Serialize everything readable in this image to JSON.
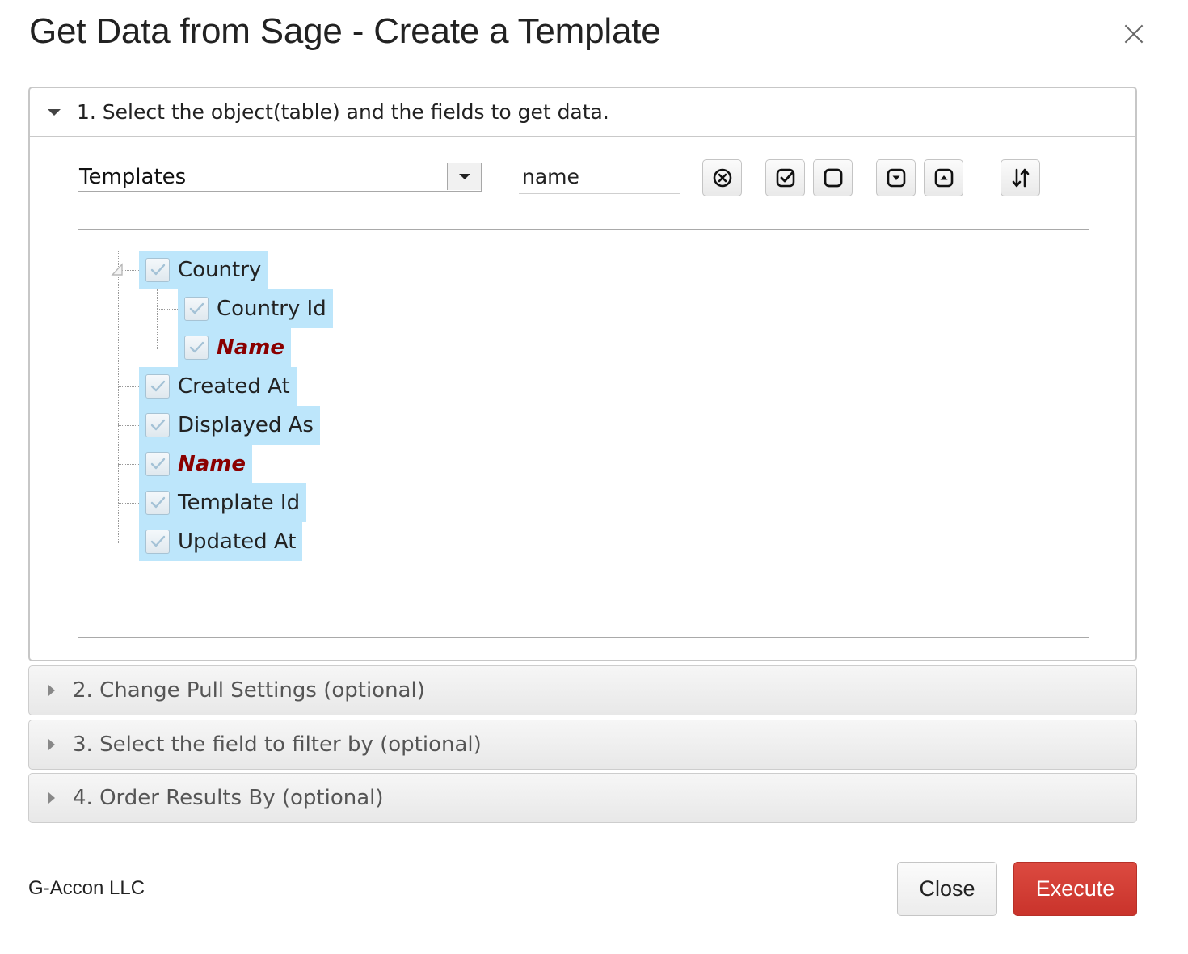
{
  "dialog": {
    "title": "Get Data from Sage - Create a Template",
    "close_icon": "close-icon"
  },
  "section1": {
    "label": "1. Select the object(table) and the fields to get data.",
    "expanded": true,
    "object_select": {
      "value": "Templates"
    },
    "search": {
      "value": "name"
    },
    "toolbar": {
      "buttons": [
        {
          "name": "clear-search-button",
          "icon": "circle-x-icon"
        },
        {
          "name": "check-all-button",
          "icon": "checked-box-icon"
        },
        {
          "name": "uncheck-all-button",
          "icon": "empty-box-icon"
        },
        {
          "name": "expand-all-button",
          "icon": "box-chevron-down-icon"
        },
        {
          "name": "collapse-all-button",
          "icon": "box-chevron-up-icon"
        },
        {
          "name": "sort-button",
          "icon": "sort-arrows-icon"
        }
      ]
    },
    "tree": {
      "root": {
        "label": "Country",
        "checked": true,
        "key": false
      },
      "root_children": [
        {
          "label": "Country Id",
          "checked": true,
          "key": false
        },
        {
          "label": "Name",
          "checked": true,
          "key": true
        }
      ],
      "items": [
        {
          "label": "Created At",
          "checked": true,
          "key": false
        },
        {
          "label": "Displayed As",
          "checked": true,
          "key": false
        },
        {
          "label": "Name",
          "checked": true,
          "key": true
        },
        {
          "label": "Template Id",
          "checked": true,
          "key": false
        },
        {
          "label": "Updated At",
          "checked": true,
          "key": false
        }
      ]
    }
  },
  "section2": {
    "label": "2. Change Pull Settings (optional)"
  },
  "section3": {
    "label": "3. Select the field to filter by (optional)"
  },
  "section4": {
    "label": "4. Order Results By (optional)"
  },
  "footer": {
    "company": "G-Accon LLC",
    "close_label": "Close",
    "execute_label": "Execute"
  },
  "colors": {
    "selected_node_bg": "#bde6fb",
    "key_field_text": "#8a0000",
    "execute_button": "#d23c33"
  }
}
